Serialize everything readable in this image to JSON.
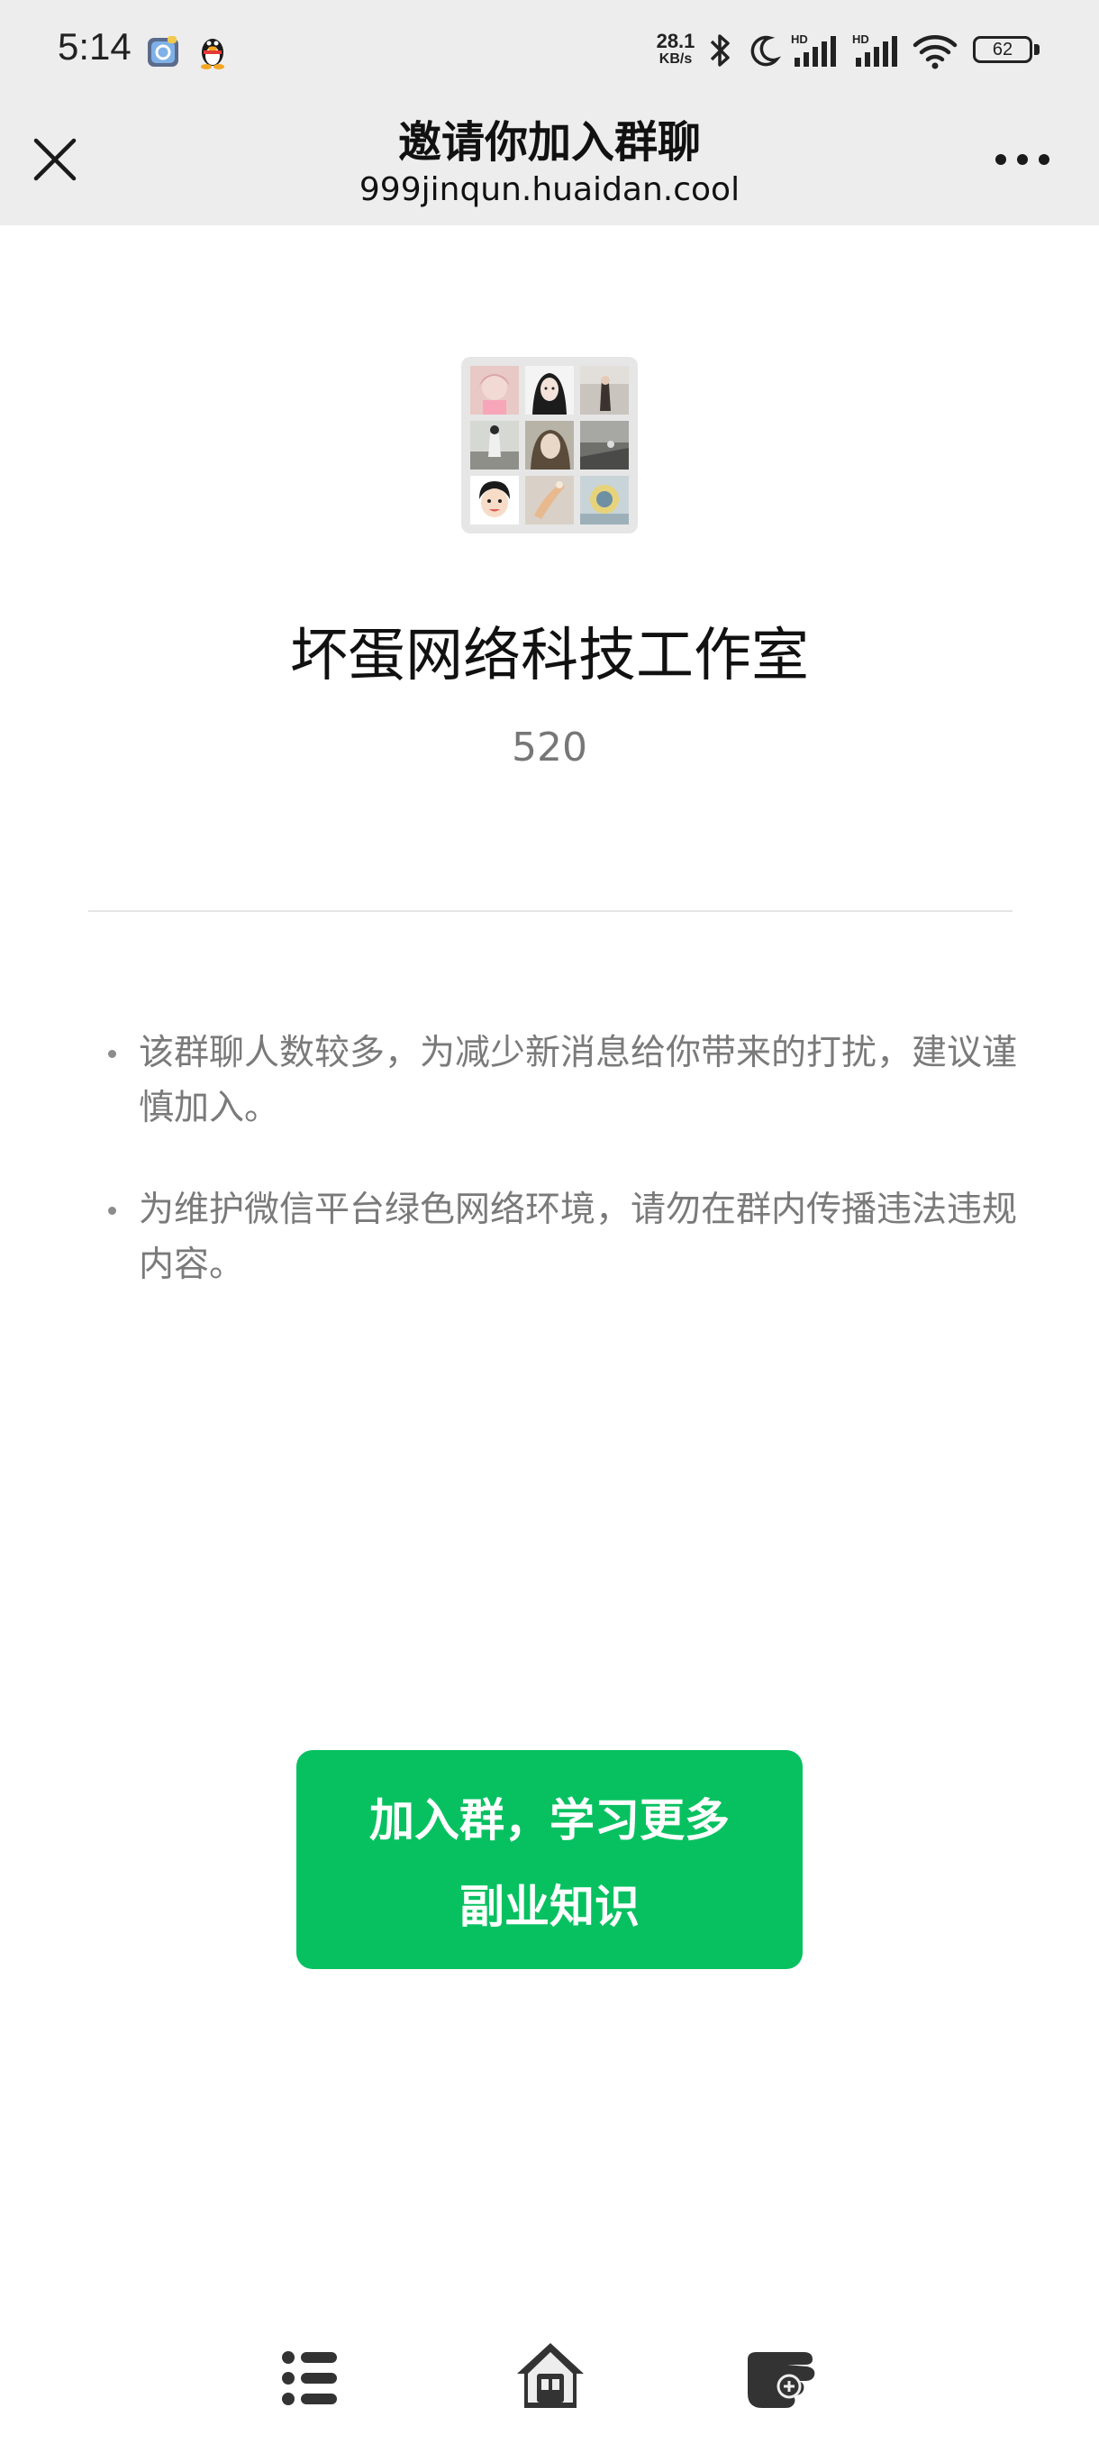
{
  "status_bar": {
    "time": "5:14",
    "net_speed_value": "28.1",
    "net_speed_unit": "KB/s",
    "battery": "62",
    "icons": [
      "app-icon",
      "qq-penguin-icon",
      "bluetooth-icon",
      "moon-icon",
      "hd-signal-icon",
      "hd-signal-icon",
      "wifi-icon",
      "battery-icon"
    ]
  },
  "header": {
    "title": "邀请你加入群聊",
    "url": "999jinqun.huaidan.cool",
    "close_icon": "close-icon",
    "more_icon": "more-dots-icon"
  },
  "group": {
    "name": "坏蛋网络科技工作室",
    "id": "520"
  },
  "notices": [
    {
      "text": "该群聊人数较多，为减少新消息给你带来的打扰，建议谨慎加入。"
    },
    {
      "text": "为维护微信平台绿色网络环境，请勿在群内传播违法违规内容。"
    }
  ],
  "join_button": {
    "line1": "加入群，学习更多",
    "line2": "副业知识"
  },
  "bottom_nav": {
    "icons": [
      "list-icon",
      "home-icon",
      "hand-point-icon"
    ]
  },
  "colors": {
    "accent": "#07c160",
    "header_bg": "#ededed",
    "muted_text": "#7a7a7a"
  }
}
